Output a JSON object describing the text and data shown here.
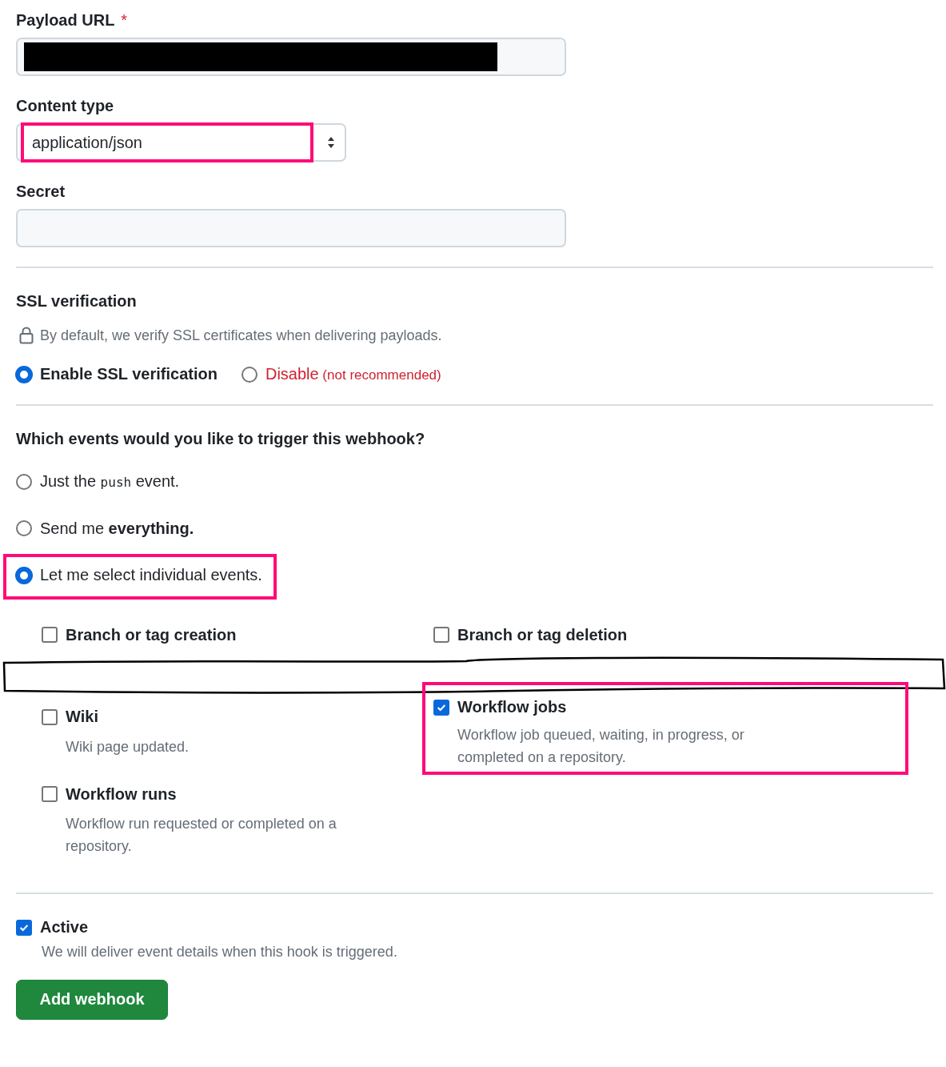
{
  "payload_url": {
    "label": "Payload URL",
    "required_mark": "*",
    "redacted": true
  },
  "content_type": {
    "label": "Content type",
    "value": "application/json",
    "highlighted": true
  },
  "secret": {
    "label": "Secret"
  },
  "ssl": {
    "title": "SSL verification",
    "note": "By default, we verify SSL certificates when delivering payloads.",
    "options": [
      {
        "label": "Enable SSL verification",
        "kind": "normal",
        "selected": true
      },
      {
        "label": "Disable",
        "suffix": "(not recommended)",
        "kind": "danger",
        "selected": false
      }
    ]
  },
  "events": {
    "question": "Which events would you like to trigger this webhook?",
    "options": [
      {
        "parts": [
          {
            "text": "Just the ",
            "kind": "plain"
          },
          {
            "text": "push",
            "kind": "code"
          },
          {
            "text": " event.",
            "kind": "plain"
          }
        ],
        "selected": false,
        "highlighted": false
      },
      {
        "parts": [
          {
            "text": "Send me ",
            "kind": "plain"
          },
          {
            "text": "everything.",
            "kind": "bold"
          }
        ],
        "selected": false,
        "highlighted": false
      },
      {
        "parts": [
          {
            "text": "Let me select individual events.",
            "kind": "plain"
          }
        ],
        "selected": true,
        "highlighted": true
      }
    ]
  },
  "event_top": [
    {
      "title": "Branch or tag creation",
      "checked": false
    },
    {
      "title": "Branch or tag deletion",
      "checked": false
    }
  ],
  "event_left": [
    {
      "title": "Wiki",
      "description": "Wiki page updated.",
      "checked": false,
      "highlighted": false
    },
    {
      "title": "Workflow runs",
      "description": "Workflow run requested or completed on a repository.",
      "checked": false,
      "highlighted": false
    }
  ],
  "event_right": [
    {
      "title": "Workflow jobs",
      "description": "Workflow job queued, waiting, in progress, or completed on a repository.",
      "checked": true,
      "highlighted": true
    }
  ],
  "active": {
    "label": "Active",
    "checked": true,
    "description": "We will deliver event details when this hook is triggered."
  },
  "submit": "Add webhook"
}
